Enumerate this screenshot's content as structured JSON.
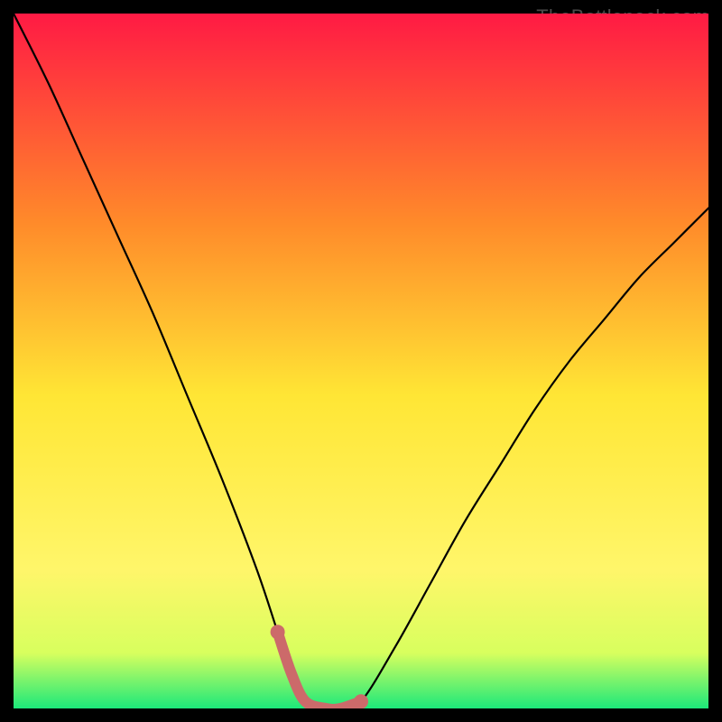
{
  "watermark": "TheBottleneck.com",
  "colors": {
    "background": "#000000",
    "gradient_top": "#ff1a44",
    "gradient_mid_upper": "#ff8a2a",
    "gradient_mid": "#ffe635",
    "gradient_mid_lower": "#fff66a",
    "gradient_near_bottom": "#d8ff5e",
    "gradient_bottom": "#1ce87a",
    "curve": "#000000",
    "highlight": "#cc6a6a"
  },
  "chart_data": {
    "type": "line",
    "title": "",
    "xlabel": "",
    "ylabel": "",
    "xlim": [
      0,
      100
    ],
    "ylim": [
      0,
      100
    ],
    "series": [
      {
        "name": "bottleneck-curve",
        "x": [
          0,
          5,
          10,
          15,
          20,
          25,
          30,
          35,
          38,
          40,
          42,
          45,
          47,
          50,
          55,
          60,
          65,
          70,
          75,
          80,
          85,
          90,
          95,
          100
        ],
        "y": [
          100,
          90,
          79,
          68,
          57,
          45,
          33,
          20,
          11,
          5,
          1,
          0,
          0,
          1,
          9,
          18,
          27,
          35,
          43,
          50,
          56,
          62,
          67,
          72
        ]
      }
    ],
    "highlight_segment": {
      "name": "optimal-range",
      "x": [
        38,
        40,
        42,
        45,
        47,
        50
      ],
      "y": [
        11,
        5,
        1,
        0,
        0,
        1
      ]
    },
    "annotations": [
      {
        "text": "TheBottleneck.com",
        "position": "top-right"
      }
    ]
  }
}
